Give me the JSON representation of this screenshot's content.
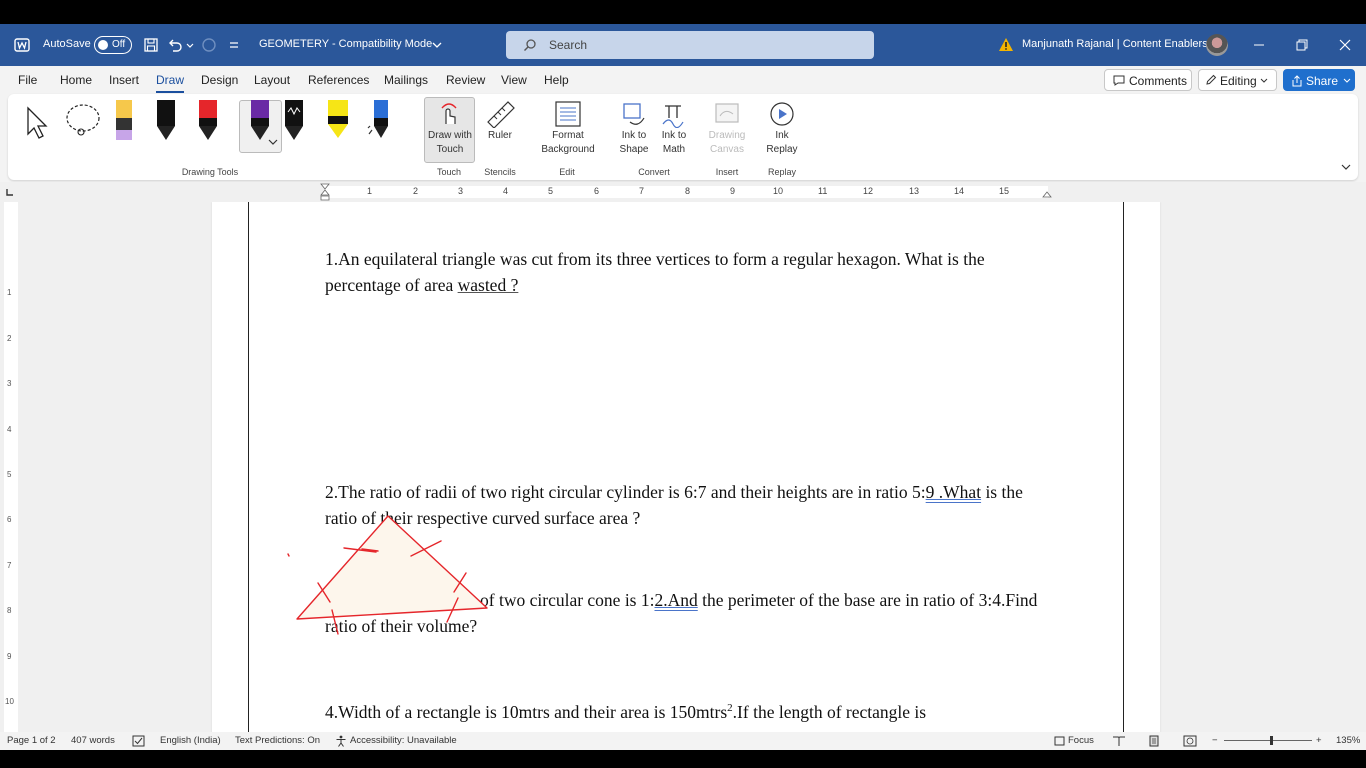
{
  "colors": {
    "brand": "#2b579a",
    "accent": "#1b4f9e",
    "ink": "#e5262b",
    "share": "#1f6fcd"
  },
  "titlebar": {
    "autosave_label": "AutoSave",
    "autosave_state": "Off",
    "doc_title": "GEOMETERY  -  Compatibility Mode",
    "search_placeholder": "Search",
    "user_name": "Manjunath Rajanal | Content Enablers"
  },
  "menu": {
    "items": [
      "File",
      "Home",
      "Insert",
      "Draw",
      "Design",
      "Layout",
      "References",
      "Mailings",
      "Review",
      "View",
      "Help"
    ],
    "active": "Draw",
    "comments": "Comments",
    "editing": "Editing",
    "share": "Share"
  },
  "ribbon": {
    "groups": {
      "drawing_tools": "Drawing Tools",
      "touch": "Touch",
      "stencils": "Stencils",
      "edit": "Edit",
      "convert": "Convert",
      "insert": "Insert",
      "replay": "Replay"
    },
    "buttons": {
      "draw_with_touch_1": "Draw with",
      "draw_with_touch_2": "Touch",
      "ruler": "Ruler",
      "format_background_1": "Format",
      "format_background_2": "Background",
      "ink_to_shape_1": "Ink to",
      "ink_to_shape_2": "Shape",
      "ink_to_math_1": "Ink to",
      "ink_to_math_2": "Math",
      "drawing_canvas_1": "Drawing",
      "drawing_canvas_2": "Canvas",
      "ink_replay_1": "Ink",
      "ink_replay_2": "Replay"
    }
  },
  "ruler": {
    "numbers": [
      "1",
      "2",
      "3",
      "4",
      "5",
      "6",
      "7",
      "8",
      "9",
      "10",
      "11",
      "12",
      "13",
      "14",
      "15"
    ],
    "vertical_numbers": [
      "1",
      "2",
      "3",
      "4",
      "5",
      "6",
      "7",
      "8",
      "9",
      "10"
    ]
  },
  "document": {
    "q1_text": "1.An equilateral triangle was cut from its three vertices to form a regular hexagon. What is the percentage of area ",
    "q1_underlined": "wasted ?",
    "q2_before": "2.The ratio of radii of two right circular cylinder is 6:7 and their heights are in ratio 5:",
    "q2_underlined": "9 .What",
    "q2_after": " is the ratio of their respective curved surface area ?",
    "q3_before": "3.The ratio of heights of two circular cone is 1:",
    "q3_underlined": "2.And",
    "q3_after": " the perimeter of the base are in ratio of 3:4.Find ratio of their volume?",
    "q4_before": "4.Width of a rectangle is 10mtrs and their area is 150mtrs",
    "q4_sup": "2",
    "q4_after": ".If the length of rectangle is"
  },
  "status": {
    "page": "Page 1 of 2",
    "words": "407 words",
    "language": "English (India)",
    "predictions": "Text Predictions: On",
    "accessibility": "Accessibility: Unavailable",
    "focus": "Focus",
    "zoom": "135%"
  }
}
